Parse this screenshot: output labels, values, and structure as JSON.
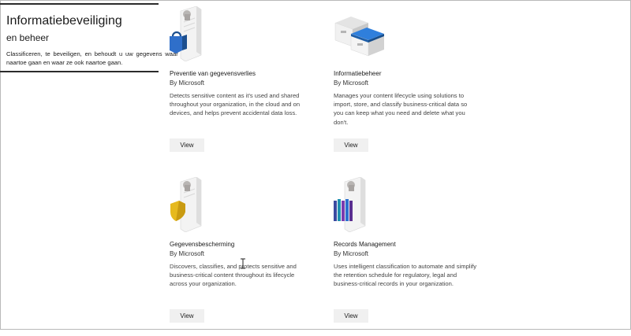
{
  "panel": {
    "title": "Informatiebeveiliging",
    "subtitle": "en beheer",
    "description": "Classificeren, te beveiligen, en behoudt u uw gegevens waar deze naartoe gaan en waar ze ook naartoe gaan."
  },
  "cards": [
    {
      "title": "Preventie van gegevensverlies",
      "publisher": "By Microsoft",
      "description": "Detects sensitive content as it's used and shared throughout your organization, in the cloud and on devices, and helps prevent accidental data loss.",
      "button": "View",
      "icon": "document-lock-icon"
    },
    {
      "title": "Informatiebeheer",
      "publisher": "By Microsoft",
      "description": "Manages your content lifecycle using solutions to import, store, and classify business-critical data so you can keep what you need and delete what you don't.",
      "button": "View",
      "icon": "archive-boxes-icon"
    },
    {
      "title": "Gegevensbescherming",
      "publisher": "By Microsoft",
      "description": "Discovers, classifies, and protects sensitive and business-critical content throughout its lifecycle across your organization.",
      "button": "View",
      "icon": "document-shield-icon"
    },
    {
      "title": "Records Management",
      "publisher": "By Microsoft",
      "description": "Uses intelligent classification to automate and simplify the retention schedule for regulatory, legal and business-critical records in your organization.",
      "button": "View",
      "icon": "document-binders-icon"
    }
  ]
}
